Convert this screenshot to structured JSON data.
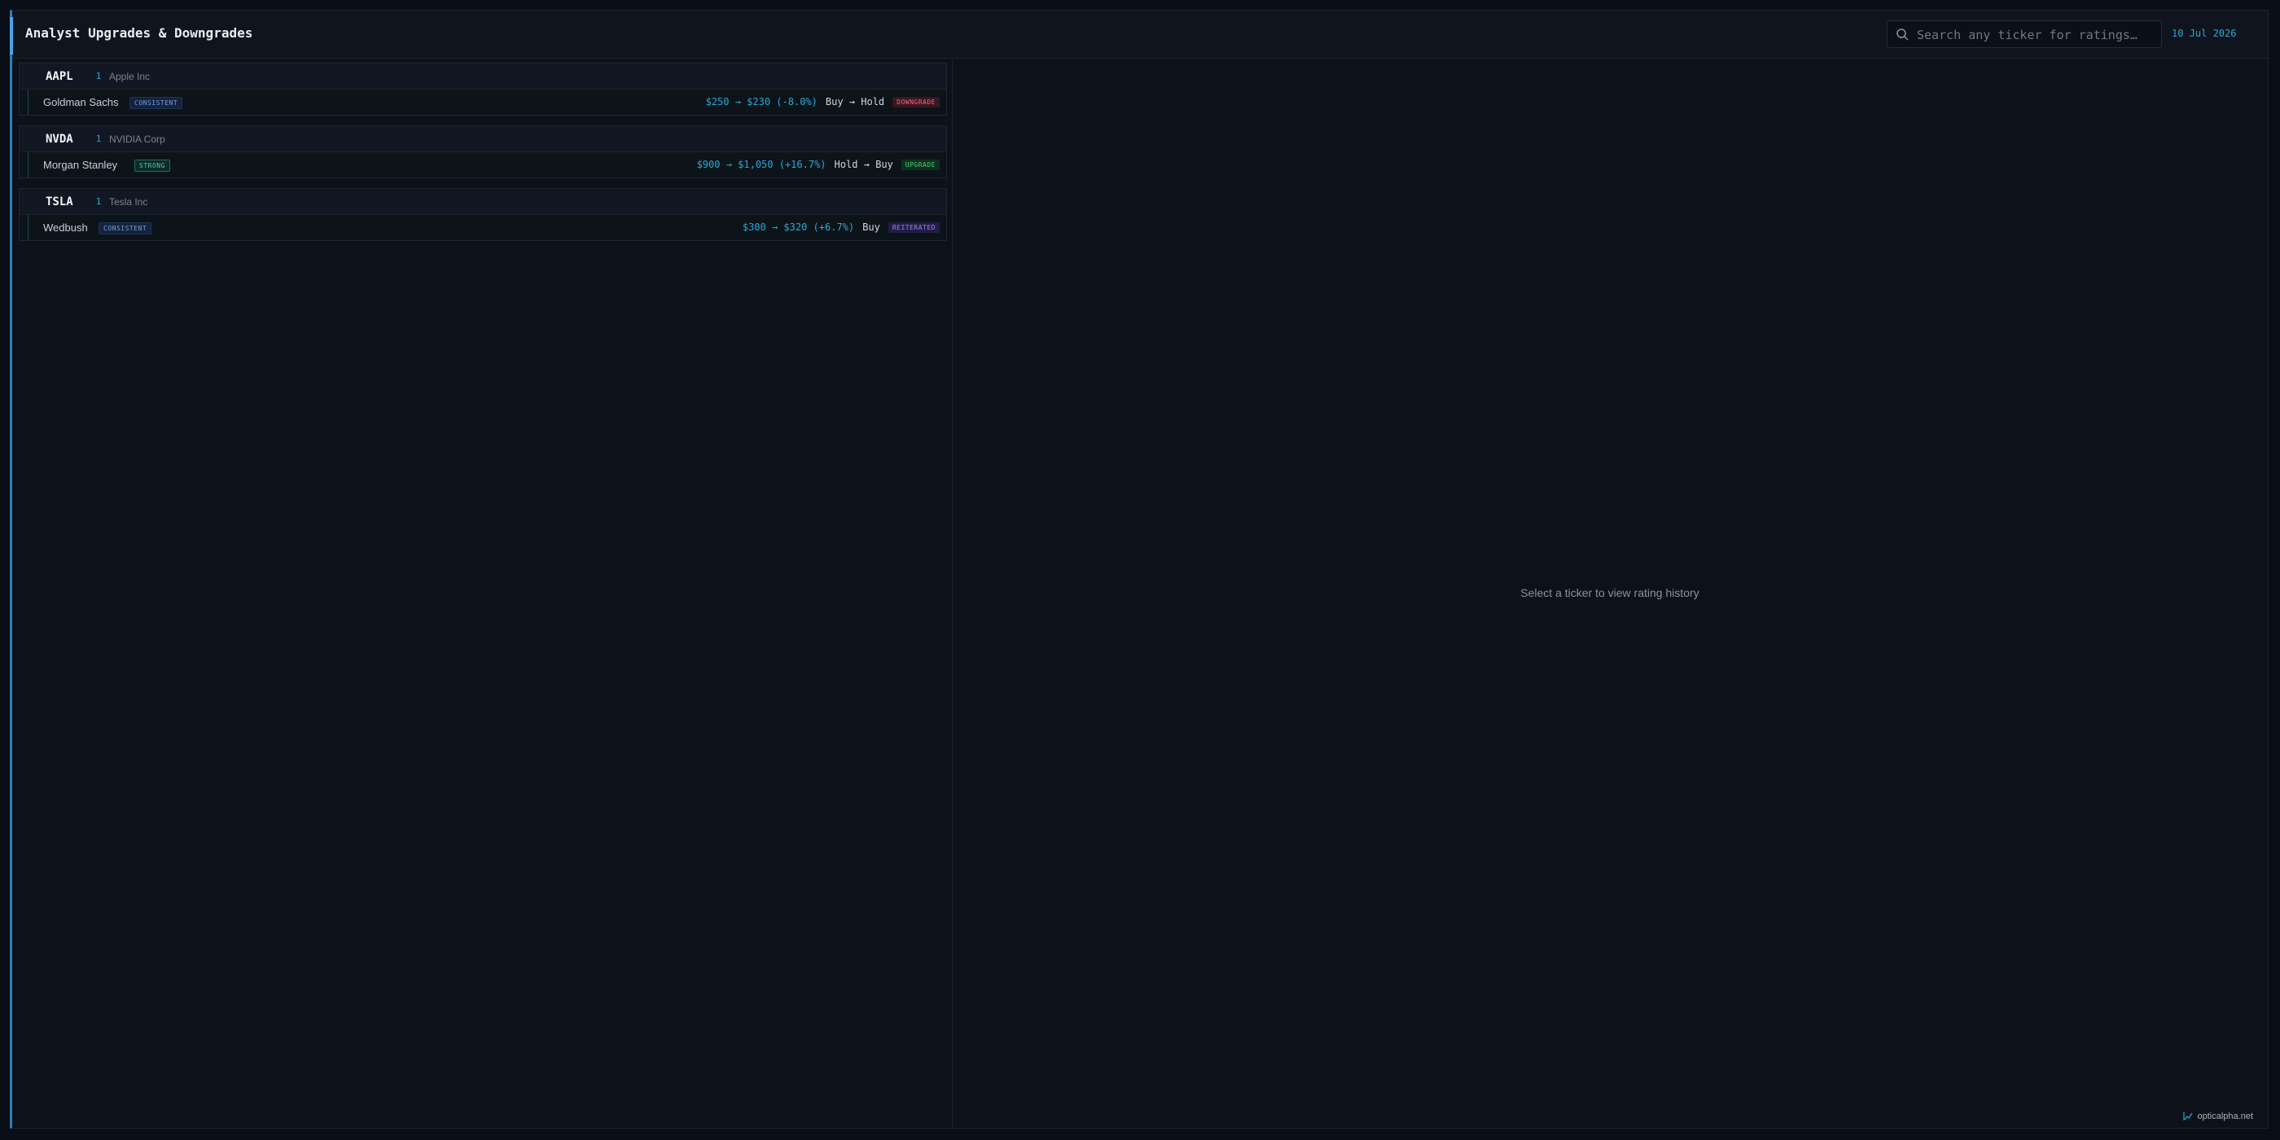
{
  "header": {
    "title": "Analyst Upgrades & Downgrades",
    "search_placeholder": "Search any ticker for ratings…",
    "date": "10 Jul 2026"
  },
  "groups": [
    {
      "symbol": "AAPL",
      "count": "1",
      "company": "Apple Inc",
      "rows": [
        {
          "firm": "Goldman Sachs",
          "tag": "CONSISTENT",
          "price_target": "$250 → $230 (-8.0%)",
          "rating": "Buy → Hold",
          "action": "DOWNGRADE"
        }
      ]
    },
    {
      "symbol": "NVDA",
      "count": "1",
      "company": "NVIDIA Corp",
      "rows": [
        {
          "firm": "Morgan Stanley",
          "tag": "STRONG",
          "price_target": "$900 → $1,050 (+16.7%)",
          "rating": "Hold → Buy",
          "action": "UPGRADE"
        }
      ]
    },
    {
      "symbol": "TSLA",
      "count": "1",
      "company": "Tesla Inc",
      "rows": [
        {
          "firm": "Wedbush",
          "tag": "CONSISTENT",
          "price_target": "$300 → $320 (+6.7%)",
          "rating": "Buy",
          "action": "REITERATED"
        }
      ]
    }
  ],
  "detail": {
    "empty_message": "Select a ticker to view rating history"
  },
  "footer": {
    "brand": "opticalpha.net"
  },
  "icons": {
    "search": "search-icon",
    "brand": "chart-trend-icon"
  },
  "colors": {
    "accent": "#2aa8d4",
    "downgrade": "#f06c7c",
    "upgrade": "#44d17a",
    "reiterated": "#9c83f2"
  }
}
